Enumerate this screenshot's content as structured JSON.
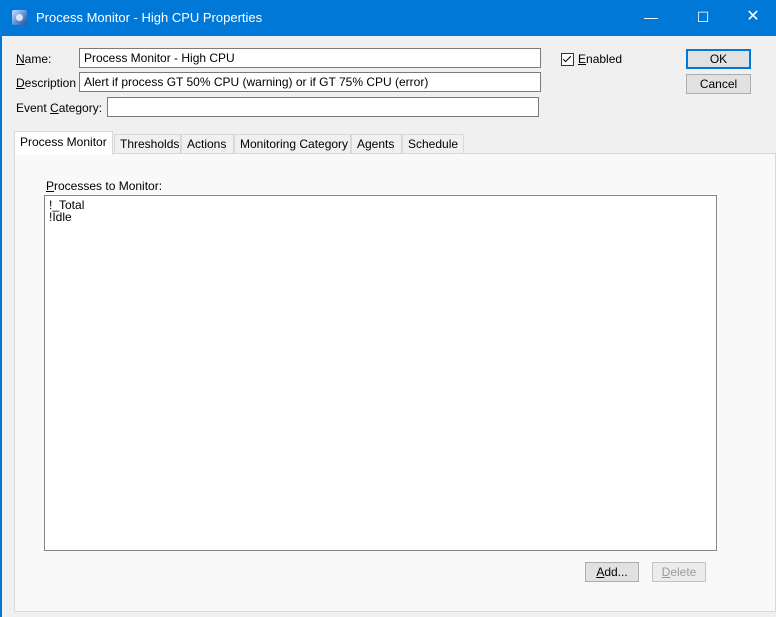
{
  "window": {
    "title": "Process Monitor - High CPU Properties",
    "controls": {
      "minimize": "—",
      "maximize": "☐",
      "close": "✕"
    }
  },
  "form": {
    "name_label": {
      "mnemonic": "N",
      "rest": "ame:"
    },
    "name_value": "Process Monitor - High CPU",
    "description_label": {
      "mnemonic": "D",
      "rest": "escription"
    },
    "description_value": "Alert if process GT 50% CPU (warning) or if GT 75% CPU (error)",
    "event_category_label": {
      "pre": "Event ",
      "mnemonic": "C",
      "rest": "ategory:"
    },
    "event_category_value": "",
    "enabled": {
      "mnemonic": "E",
      "rest": "nabled",
      "checked": true
    }
  },
  "buttons": {
    "ok": "OK",
    "cancel": "Cancel"
  },
  "tabs": [
    "Process Monitor",
    "Thresholds",
    "Actions",
    "Monitoring Category",
    "Agents",
    "Schedule"
  ],
  "active_tab": "Process Monitor",
  "process_tab": {
    "list_label": {
      "mnemonic": "P",
      "rest": "rocesses to Monitor:"
    },
    "processes": [
      "!_Total",
      "!Idle"
    ],
    "add_button": {
      "mnemonic": "A",
      "rest": "dd..."
    },
    "delete_button": {
      "mnemonic": "D",
      "rest": "elete",
      "disabled": true
    }
  }
}
